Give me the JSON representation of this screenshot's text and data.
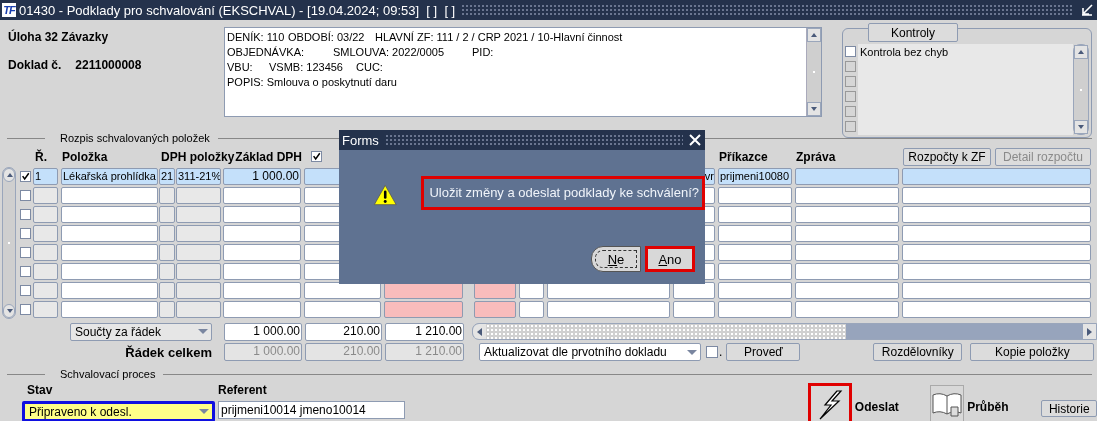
{
  "window": {
    "logo": "TF",
    "title": "01430 - Podklady pro schvalování (EKSCHVAL) - [19.04.2024; 09:53]  [ ]  [ ]"
  },
  "header": {
    "task": "Úloha 32 Závazky",
    "document_label": "Doklad č.",
    "document_number": "2211000008"
  },
  "info_box": {
    "lines": [
      [
        "DENÍK: 110",
        "OBDOBÍ: 03/22",
        "HLAVNÍ ZF: 111 / 2 / CRP 2021 / 10-Hlavní činnost"
      ],
      [
        "OBJEDNÁVKA:",
        "SMLOUVA: 2022/0005",
        "PID:"
      ],
      [
        "VBU:",
        "VSMB: 123456",
        "CUC:"
      ],
      [
        "POPIS: Smlouva o poskytnutí daru"
      ]
    ]
  },
  "checks": {
    "button": "Kontroly",
    "items": [
      {
        "label": "Kontrola bez chyb",
        "checked": false,
        "disabled": false
      },
      {
        "checked": false,
        "disabled": true
      },
      {
        "checked": false,
        "disabled": true
      },
      {
        "checked": false,
        "disabled": true
      },
      {
        "checked": false,
        "disabled": true
      },
      {
        "checked": false,
        "disabled": true
      }
    ]
  },
  "items_section": {
    "title": "Rozpis schvalovaných položek",
    "headers": [
      "Ř.",
      "Položka",
      "DPH položky",
      "Základ DPH",
      "Příkazce",
      "Zpráva"
    ],
    "header_checkbox": {
      "checked": true
    },
    "buttons": [
      {
        "label": "Rozpočty k ZF",
        "disabled": false
      },
      {
        "label": "Detail rozpočtu",
        "disabled": true
      }
    ],
    "rows": [
      {
        "checked": true,
        "selected": true,
        "cells": {
          "r": "1",
          "item": "Lékařská prohlídka",
          "vat_rate": "21",
          "vat_code": "311-21%",
          "base": "1 000.00",
          "column_11": "vr",
          "approver": "prijmeni10080"
        }
      },
      {
        "checked": false,
        "selected": false,
        "cells": {}
      },
      {
        "checked": false,
        "selected": false,
        "cells": {}
      },
      {
        "checked": false,
        "selected": false,
        "cells": {}
      },
      {
        "checked": false,
        "selected": false,
        "cells": {}
      },
      {
        "checked": false,
        "selected": false,
        "cells": {}
      },
      {
        "checked": false,
        "selected": false,
        "cells": {}
      },
      {
        "checked": false,
        "selected": false,
        "cells": {}
      }
    ],
    "totals": {
      "mode": "Součty za řádek",
      "values": [
        "1 000.00",
        "210.00",
        "1 210.00"
      ]
    },
    "row_total": {
      "label": "Řádek celkem",
      "values": [
        "1 000.00",
        "210.00",
        "1 210.00"
      ]
    },
    "update_select": "Aktualizovat dle prvotního dokladu",
    "update_checkbox": {
      "checked": false,
      "label": "."
    },
    "run_button": "Proveď",
    "tool_buttons": [
      "Rozdělovníky",
      "Kopie položky"
    ]
  },
  "approval": {
    "title": "Schvalovací proces",
    "state_label": "Stav",
    "state": "Připraveno k odesl.",
    "state_focused": true,
    "referent_label": "Referent",
    "referent": "prijmeni10014 jmeno10014",
    "send": {
      "label": "Odeslat",
      "highlighted": true
    },
    "progress": {
      "label": "Průběh"
    },
    "history_button": "Historie"
  },
  "dialog": {
    "title": "Forms",
    "message": "Uložit změny a odeslat podklady ke schválení?",
    "message_highlighted": true,
    "buttons": [
      {
        "label": "Ne",
        "focused": true,
        "highlighted": false
      },
      {
        "label": "Ano",
        "focused": false,
        "highlighted": true
      }
    ]
  }
}
